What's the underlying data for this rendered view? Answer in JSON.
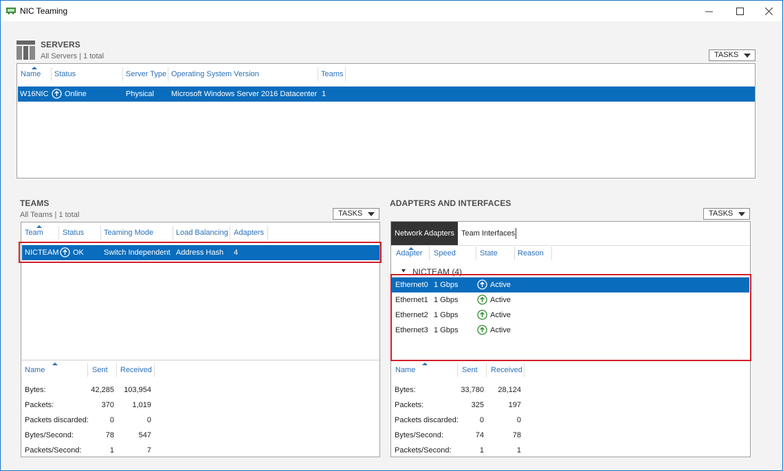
{
  "window": {
    "title": "NIC Teaming",
    "minimize": "—",
    "maximize": "☐",
    "close": "✕"
  },
  "servers": {
    "title": "SERVERS",
    "subtitle": "All Servers | 1 total",
    "tasks_label": "TASKS",
    "columns": [
      "Name",
      "Status",
      "Server Type",
      "Operating System Version",
      "Teams"
    ],
    "rows": [
      {
        "name": "W16NIC",
        "status": "Online",
        "server_type": "Physical",
        "os": "Microsoft Windows Server 2016 Datacenter",
        "teams": "1"
      }
    ]
  },
  "teams": {
    "title": "TEAMS",
    "subtitle": "All Teams | 1 total",
    "tasks_label": "TASKS",
    "columns": [
      "Team",
      "Status",
      "Teaming Mode",
      "Load Balancing",
      "Adapters"
    ],
    "rows": [
      {
        "team": "NICTEAM",
        "status": "OK",
        "mode": "Switch Independent",
        "balancing": "Address Hash",
        "adapters": "4"
      }
    ],
    "stats": {
      "columns": [
        "Name",
        "Sent",
        "Received"
      ],
      "rows": [
        {
          "name": "Bytes:",
          "sent": "42,285",
          "received": "103,954"
        },
        {
          "name": "Packets:",
          "sent": "370",
          "received": "1,019"
        },
        {
          "name": "Packets discarded:",
          "sent": "0",
          "received": "0"
        },
        {
          "name": "Bytes/Second:",
          "sent": "78",
          "received": "547"
        },
        {
          "name": "Packets/Second:",
          "sent": "1",
          "received": "7"
        }
      ]
    }
  },
  "adapters": {
    "title": "ADAPTERS AND INTERFACES",
    "tasks_label": "TASKS",
    "tabs": [
      "Network Adapters",
      "Team Interfaces"
    ],
    "columns": [
      "Adapter",
      "Speed",
      "State",
      "Reason"
    ],
    "group_label": "NICTEAM (4)",
    "rows": [
      {
        "adapter": "Ethernet0",
        "speed": "1 Gbps",
        "state": "Active",
        "reason": ""
      },
      {
        "adapter": "Ethernet1",
        "speed": "1 Gbps",
        "state": "Active",
        "reason": ""
      },
      {
        "adapter": "Ethernet2",
        "speed": "1 Gbps",
        "state": "Active",
        "reason": ""
      },
      {
        "adapter": "Ethernet3",
        "speed": "1 Gbps",
        "state": "Active",
        "reason": ""
      }
    ],
    "stats": {
      "columns": [
        "Name",
        "Sent",
        "Received"
      ],
      "rows": [
        {
          "name": "Bytes:",
          "sent": "33,780",
          "received": "28,124"
        },
        {
          "name": "Packets:",
          "sent": "325",
          "received": "197"
        },
        {
          "name": "Packets discarded:",
          "sent": "0",
          "received": "0"
        },
        {
          "name": "Bytes/Second:",
          "sent": "74",
          "received": "78"
        },
        {
          "name": "Packets/Second:",
          "sent": "1",
          "received": "1"
        }
      ]
    }
  },
  "colors": {
    "selection": "#0a6cbc",
    "header_text": "#2a70b8",
    "highlight_box": "#d21f2b",
    "status_ok": "#2e8b2e"
  }
}
